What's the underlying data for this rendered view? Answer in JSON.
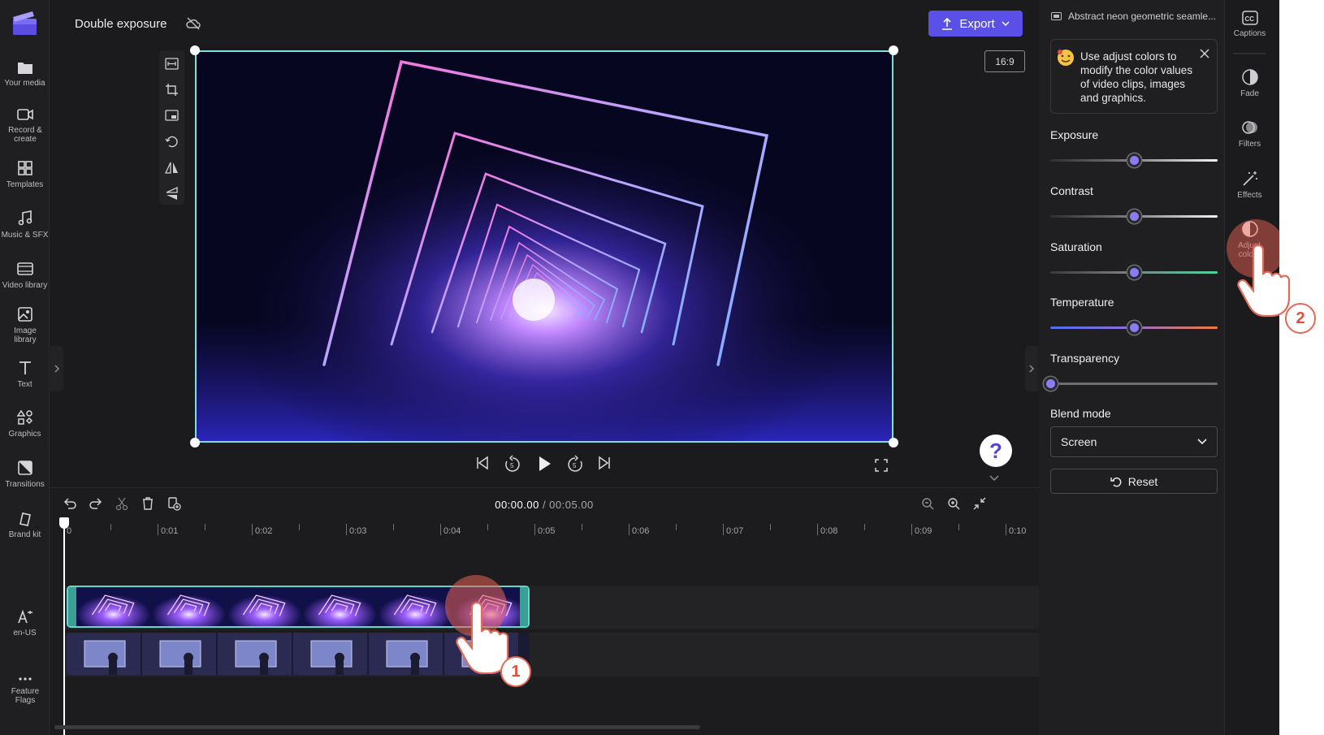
{
  "app": {
    "project_title": "Double exposure",
    "export_label": "Export",
    "aspect_ratio": "16:9"
  },
  "left_nav": [
    {
      "label": "Your media",
      "icon": "folder-icon"
    },
    {
      "label": "Record & create",
      "icon": "camera-icon"
    },
    {
      "label": "Templates",
      "icon": "templates-icon"
    },
    {
      "label": "Music & SFX",
      "icon": "music-icon"
    },
    {
      "label": "Video library",
      "icon": "film-icon"
    },
    {
      "label": "Image library",
      "icon": "image-icon"
    },
    {
      "label": "Text",
      "icon": "text-icon"
    },
    {
      "label": "Graphics",
      "icon": "shapes-icon"
    },
    {
      "label": "Transitions",
      "icon": "transitions-icon"
    },
    {
      "label": "Brand kit",
      "icon": "brand-kit-icon"
    },
    {
      "label": "en-US",
      "icon": "language-icon"
    },
    {
      "label": "Feature Flags",
      "icon": "more-icon"
    }
  ],
  "timeline": {
    "current_time": "00:00.00",
    "total_time": "/ 00:05.00",
    "ruler": [
      "0",
      "0:01",
      "0:02",
      "0:03",
      "0:04",
      "0:05",
      "0:06",
      "0:07",
      "0:08",
      "0:09",
      "0:10"
    ]
  },
  "properties": {
    "clip_title": "Abstract neon geometric seamle...",
    "tip": "Use adjust colors to modify the color values of video clips, images and graphics.",
    "sliders": [
      {
        "label": "Exposure",
        "value": 0.5
      },
      {
        "label": "Contrast",
        "value": 0.5
      },
      {
        "label": "Saturation",
        "value": 0.5
      },
      {
        "label": "Temperature",
        "value": 0.5
      },
      {
        "label": "Transparency",
        "value": 0
      }
    ],
    "blend_mode_label": "Blend mode",
    "blend_mode_value": "Screen",
    "reset_label": "Reset"
  },
  "right_rail": [
    {
      "label": "Captions",
      "icon": "captions-icon"
    },
    {
      "label": "Fade",
      "icon": "fade-icon"
    },
    {
      "label": "Filters",
      "icon": "filters-icon"
    },
    {
      "label": "Effects",
      "icon": "effects-icon"
    },
    {
      "label": "Adjust colors",
      "icon": "adjust-colors-icon"
    }
  ],
  "tutorial": {
    "step1": "1",
    "step2": "2"
  },
  "colors": {
    "accent": "#5a4fe6",
    "selection": "#64d7c9",
    "highlight": "#e46a58"
  }
}
